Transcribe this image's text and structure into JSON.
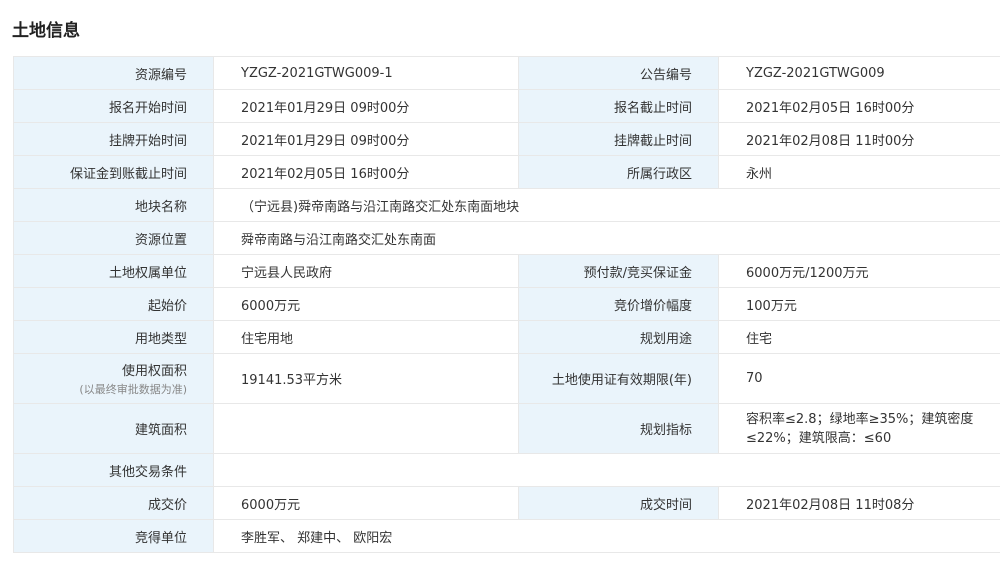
{
  "page": {
    "title": "土地信息"
  },
  "rows": [
    {
      "l1": "资源编号",
      "v1": "YZGZ-2021GTWG009-1",
      "l2": "公告编号",
      "v2": "YZGZ-2021GTWG009"
    },
    {
      "l1": "报名开始时间",
      "v1": "2021年01月29日 09时00分",
      "l2": "报名截止时间",
      "v2": "2021年02月05日 16时00分"
    },
    {
      "l1": "挂牌开始时间",
      "v1": "2021年01月29日 09时00分",
      "l2": "挂牌截止时间",
      "v2": "2021年02月08日 11时00分"
    },
    {
      "l1": "保证金到账截止时间",
      "v1": "2021年02月05日 16时00分",
      "l2": "所属行政区",
      "v2": "永州"
    },
    {
      "l1": "地块名称",
      "v1": "（宁远县)舜帝南路与沿江南路交汇处东南面地块"
    },
    {
      "l1": "资源位置",
      "v1": "舜帝南路与沿江南路交汇处东南面"
    },
    {
      "l1": "土地权属单位",
      "v1": "宁远县人民政府",
      "l2": "预付款/竞买保证金",
      "v2": "6000万元/1200万元"
    },
    {
      "l1": "起始价",
      "v1": "6000万元",
      "l2": "竞价增价幅度",
      "v2": "100万元"
    },
    {
      "l1": "用地类型",
      "v1": "住宅用地",
      "l2": "规划用途",
      "v2": "住宅"
    },
    {
      "l1": "使用权面积",
      "l1_note": "(以最终审批数据为准)",
      "v1": "19141.53平方米",
      "l2": "土地使用证有效期限(年)",
      "v2": "70"
    },
    {
      "l1": "建筑面积",
      "v1": "",
      "l2": "规划指标",
      "v2": "容积率≤2.8；绿地率≥35%；建筑密度≤22%；建筑限高：≤60"
    },
    {
      "l1": "其他交易条件",
      "v1": ""
    },
    {
      "l1": "成交价",
      "v1": "6000万元",
      "l2": "成交时间",
      "v2": "2021年02月08日 11时08分"
    },
    {
      "l1": "竞得单位",
      "v1": "李胜军、 郑建中、 欧阳宏"
    }
  ]
}
